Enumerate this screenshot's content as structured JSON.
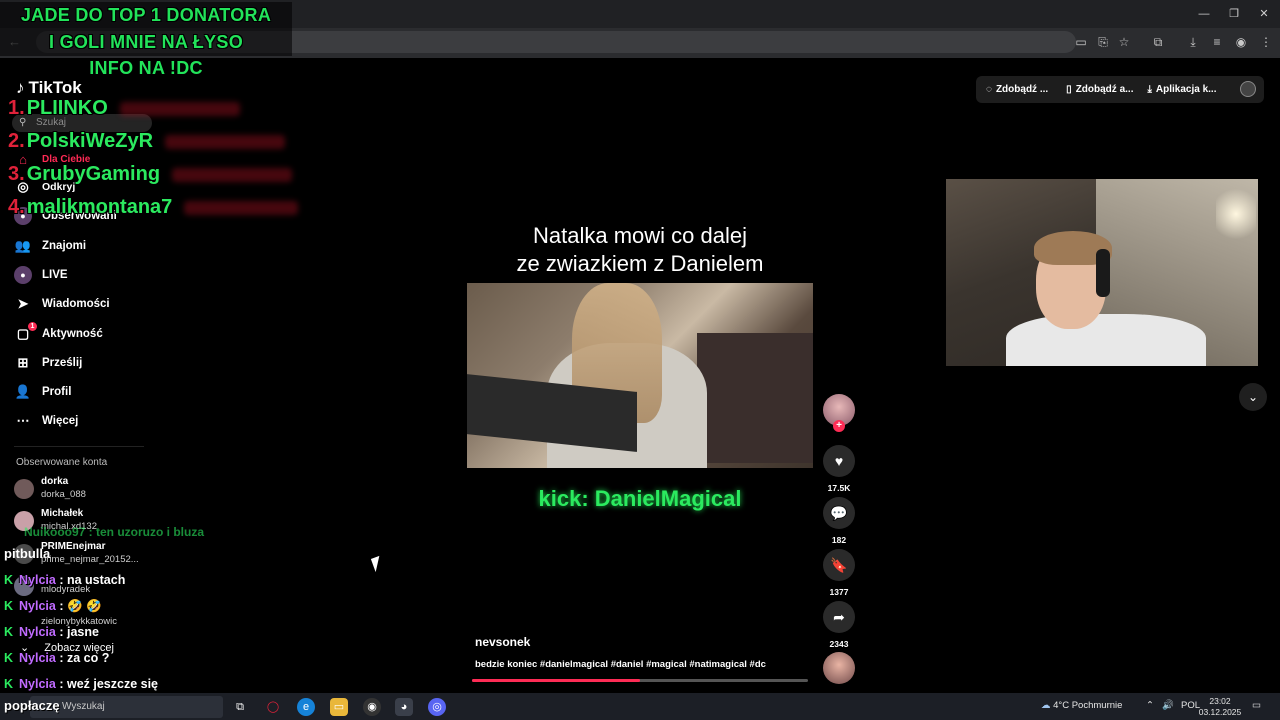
{
  "overlay": {
    "title_line1": "JADE DO TOP 1 DONATORA",
    "title_line2": "I GOLI MNIE NA ŁYSO",
    "title_line3": "INFO NA !DC",
    "donors": [
      {
        "rank": "1.",
        "name": "PLIINKO"
      },
      {
        "rank": "2.",
        "name": "PolskiWeZyR"
      },
      {
        "rank": "3.",
        "name": "GrubyGaming"
      },
      {
        "rank": "4.",
        "name": "malikmontana7"
      }
    ]
  },
  "tiktok": {
    "logo": "TikTok",
    "search_placeholder": "Szukaj",
    "nav": [
      {
        "label": "Dla Ciebie"
      },
      {
        "label": "Odkryj"
      },
      {
        "label": "Obserwowani"
      },
      {
        "label": "Znajomi"
      },
      {
        "label": "LIVE"
      },
      {
        "label": "Wiadomości"
      },
      {
        "label": "Aktywność",
        "badge": "1"
      },
      {
        "label": "Prześlij"
      },
      {
        "label": "Profil"
      },
      {
        "label": "Więcej"
      }
    ],
    "followed_title": "Obserwowane konta",
    "accounts": [
      {
        "name": "dorka",
        "handle": "dorka_088"
      },
      {
        "name": "Michałek",
        "handle": "michal.xd132"
      },
      {
        "name": "PRIMEnejmar",
        "handle": "prime_nejmar_20152..."
      },
      {
        "name": "Nylcia",
        "handle": "mlodyradek"
      },
      {
        "name": "",
        "handle": "zielonybykkatowic"
      }
    ],
    "see_more": "Zobacz więcej",
    "top_buttons": [
      {
        "label": "Zdobądź ..."
      },
      {
        "label": "Zdobądź a..."
      },
      {
        "label": "Aplikacja k..."
      }
    ]
  },
  "video": {
    "caption_line1": "Natalka mowi co dalej",
    "caption_line2": "ze zwiazkiem z Danielem",
    "kick_text": "kick: DanielMagical",
    "author": "nevsonek",
    "description": "bedzie koniec #danielmagical #daniel #magical #natimagical #dc",
    "progress": 0.5,
    "likes": "17.5K",
    "comments": "182",
    "saves": "1377",
    "shares": "2343"
  },
  "chat": {
    "faded_top": "Nuikooo97 : ten uzoruzo i bluza",
    "pitbulla": "pitbulla",
    "lines": [
      {
        "badge": "K",
        "user": "Nylcia",
        "msg": " : na ustach"
      },
      {
        "badge": "K",
        "user": "Nylcia",
        "msg": " : 🤣 🤣"
      },
      {
        "badge": "K",
        "user": "Nylcia",
        "msg": " : jasne"
      },
      {
        "badge": "K",
        "user": "Nylcia",
        "msg": " : za co ?"
      },
      {
        "badge": "K",
        "user": "Nylcia",
        "msg": " : weź jeszcze się"
      }
    ]
  },
  "taskbar": {
    "overlay_text": "popłaczę",
    "search_placeholder": "Wyszukaj",
    "weather": "4°C  Pochmurnie",
    "language": "POL",
    "time": "23:02",
    "date": "03.12.2025"
  },
  "colors": {
    "accent_green": "#2bea5f",
    "accent_red": "#fe2c55",
    "chat_user": "#c06bff"
  }
}
